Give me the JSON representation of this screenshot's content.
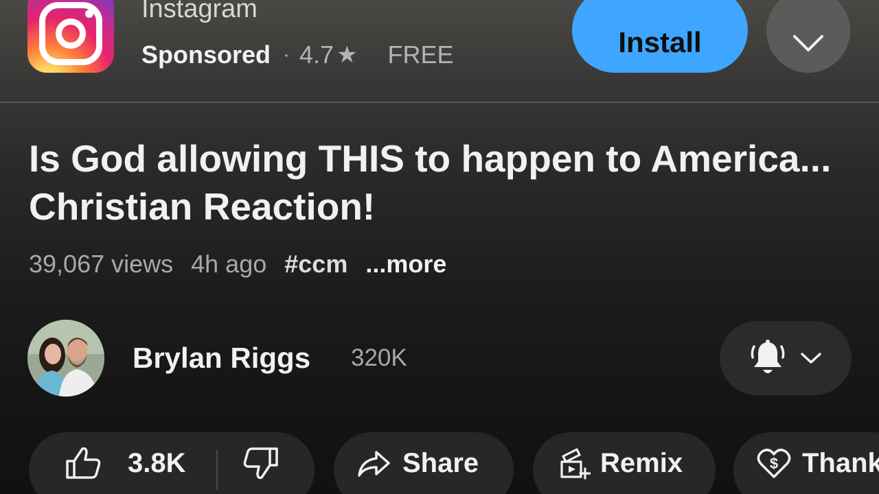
{
  "ad": {
    "app_name": "Instagram",
    "sponsored_label": "Sponsored",
    "separator": "·",
    "rating": "4.7",
    "price": "FREE",
    "install_label": "Install",
    "icons": [
      "instagram-logo",
      "star-icon",
      "chevron-down-icon"
    ],
    "colors": {
      "install_button": "#3ea6ff"
    }
  },
  "video": {
    "title": "Is God allowing THIS to happen to America... Christian Reaction!",
    "views": "39,067 views",
    "age": "4h ago",
    "hashtag": "#ccm",
    "more_label": "...more"
  },
  "channel": {
    "name": "Brylan Riggs",
    "subscribers": "320K",
    "icons": [
      "avatar",
      "bell-icon",
      "chevron-down-icon"
    ]
  },
  "actions": {
    "like_count": "3.8K",
    "share_label": "Share",
    "remix_label": "Remix",
    "thanks_label": "Thanks",
    "icons": [
      "thumbs-up-icon",
      "thumbs-down-icon",
      "share-arrow-icon",
      "remix-icon",
      "heart-dollar-icon"
    ]
  }
}
